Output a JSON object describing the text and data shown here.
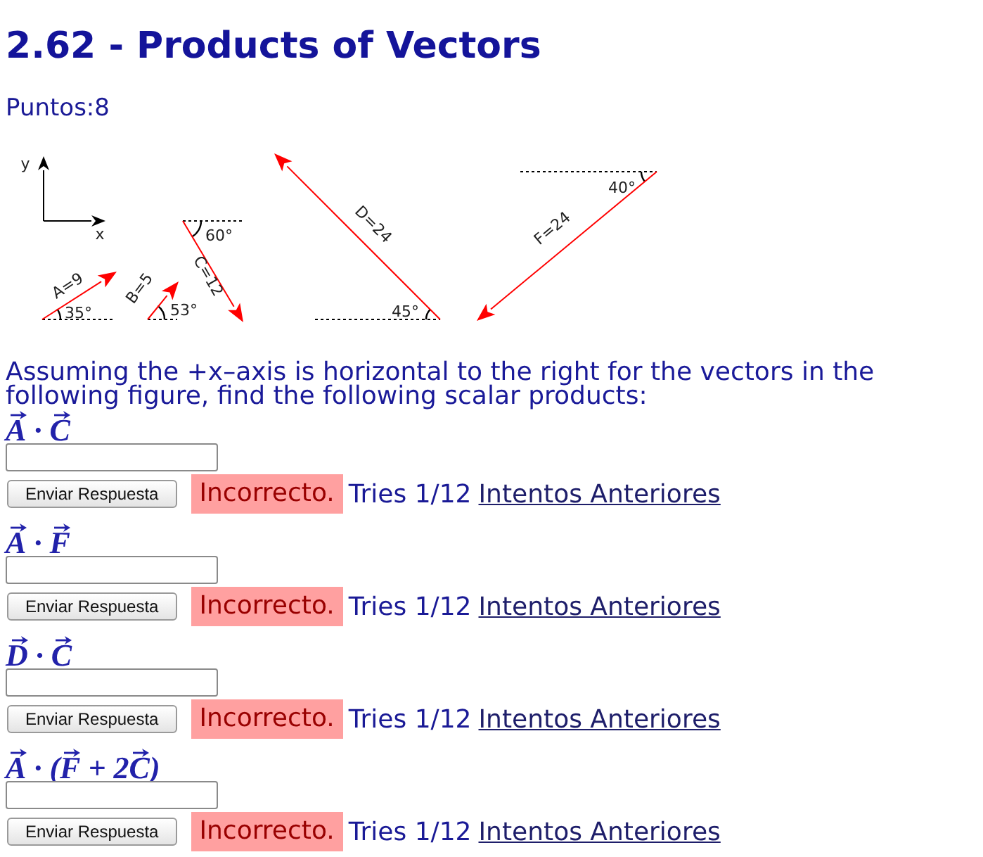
{
  "title": "2.62 - Products of Vectors",
  "points": "Puntos:8",
  "figure": {
    "axes": {
      "y": "y",
      "x": "x"
    },
    "vectors": [
      {
        "label": "A=9",
        "angle": "35°"
      },
      {
        "label": "B=5",
        "angle": "53°"
      },
      {
        "label": "C=12",
        "angle": "60°"
      },
      {
        "label": "D=24",
        "angle": "45°"
      },
      {
        "label": "F=24",
        "angle": "40°"
      }
    ]
  },
  "question": "Assuming the +x–axis is horizontal to the right for the vectors in the following figure, find the following scalar products:",
  "parts": [
    {
      "expression": [
        {
          "text": "A",
          "vector": true
        },
        {
          "text": " · ",
          "vector": false
        },
        {
          "text": "C",
          "vector": true
        }
      ],
      "button": "Enviar Respuesta",
      "correct": false,
      "feedback": "Incorrecto.",
      "tries": "Tries 1/12",
      "link": "Intentos Anteriores"
    },
    {
      "expression": [
        {
          "text": "A",
          "vector": true
        },
        {
          "text": " · ",
          "vector": false
        },
        {
          "text": "F",
          "vector": true
        }
      ],
      "button": "Enviar Respuesta",
      "correct": false,
      "feedback": "Incorrecto.",
      "tries": "Tries 1/12",
      "link": "Intentos Anteriores"
    },
    {
      "expression": [
        {
          "text": "D",
          "vector": true
        },
        {
          "text": " · ",
          "vector": false
        },
        {
          "text": "C",
          "vector": true
        }
      ],
      "button": "Enviar Respuesta",
      "correct": false,
      "feedback": "Incorrecto.",
      "tries": "Tries 1/12",
      "link": "Intentos Anteriores"
    },
    {
      "expression": [
        {
          "text": "A",
          "vector": true
        },
        {
          "text": " · (",
          "vector": false
        },
        {
          "text": "F",
          "vector": true
        },
        {
          "text": " + 2",
          "vector": false
        },
        {
          "text": "C",
          "vector": true
        },
        {
          "text": ")",
          "vector": false
        }
      ],
      "button": "Enviar Respuesta",
      "correct": false,
      "feedback": "Incorrecto.",
      "tries": "Tries 1/12",
      "link": "Intentos Anteriores"
    }
  ]
}
